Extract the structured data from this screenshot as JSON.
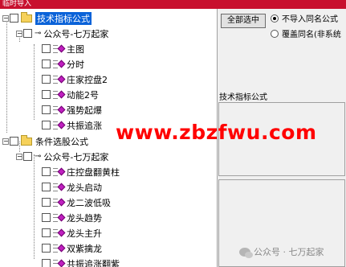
{
  "window": {
    "title": "临时导入"
  },
  "tree": {
    "groups": [
      {
        "label": "技术指标公式",
        "selected": true,
        "account": "公众号-七万起家",
        "items": [
          "主图",
          "分时",
          "庄家控盘2",
          "动能2号",
          "强势起爆",
          "共振追涨"
        ]
      },
      {
        "label": "条件选股公式",
        "selected": false,
        "account": "公众号-七万起家",
        "items": [
          "庄控盘翻黄柱",
          "龙头启动",
          "龙二波低吸",
          "龙头趋势",
          "龙头主升",
          "双紫擒龙",
          "共振追涨翻紫"
        ]
      }
    ]
  },
  "controls": {
    "select_all_label": "全部选中",
    "options": [
      {
        "label": "不导入同名公式",
        "checked": true
      },
      {
        "label": "覆盖同名(非系统",
        "checked": false
      }
    ],
    "section_label": "技术指标公式"
  },
  "overlays": {
    "watermark": "www.zbzfwu.com",
    "wechat_badge": "公众号 · 七万起家"
  }
}
